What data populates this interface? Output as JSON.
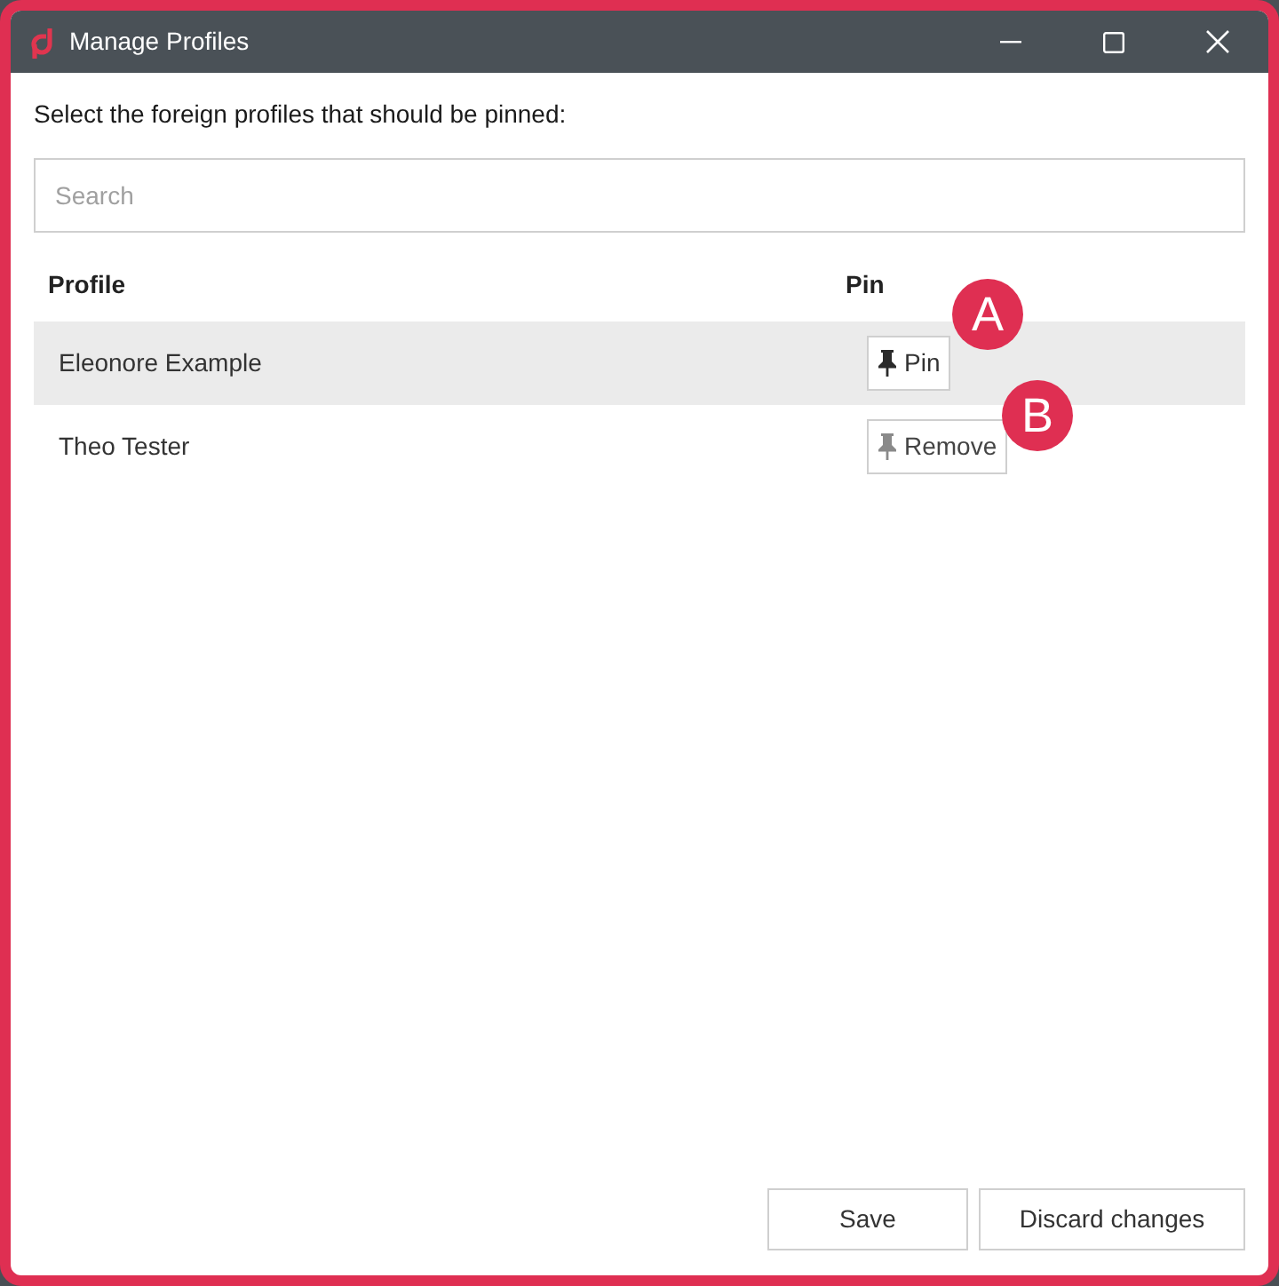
{
  "window": {
    "title": "Manage Profiles"
  },
  "instruction": "Select the foreign profiles that should be pinned:",
  "search": {
    "placeholder": "Search"
  },
  "table": {
    "columns": [
      "Profile",
      "Pin"
    ],
    "rows": [
      {
        "name": "Eleonore Example",
        "selected": true,
        "pinned": false,
        "button": "Pin",
        "callout": "A"
      },
      {
        "name": "Theo Tester",
        "selected": false,
        "pinned": true,
        "button": "Remove",
        "callout": "B"
      }
    ]
  },
  "buttons": [
    "Save",
    "Discard changes"
  ]
}
